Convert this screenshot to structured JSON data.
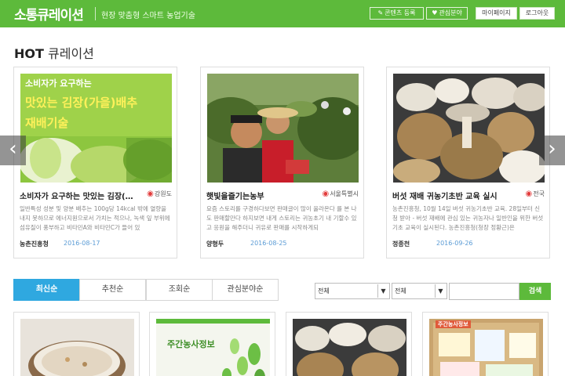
{
  "header": {
    "brand": "소통큐레이션",
    "tagline": "현장 맞춤형 스마트 농업기술",
    "buttons": {
      "register": "콘텐츠 등록",
      "interest": "관심분야",
      "mypage": "마이페이지",
      "logout": "로그아웃"
    },
    "colors": {
      "primary": "#5dba3b"
    }
  },
  "hot": {
    "title_bold": "HOT",
    "title_rest": "큐레이션",
    "cards": [
      {
        "title": "소비자가 요구하는 맛있는 김장(가을)배추 재배기술",
        "location": "강원도",
        "desc": "일반특성 성분 및 양분 배추는 100g당 14kcal 밖에 열량을 내지 못하므로 에너지원으로서 가치는 적으나, 녹색 잎 부위에 섬유질이 풍부하고 비타민A와 비타민C가 들어 있",
        "author": "농촌진흥청",
        "date": "2016-08-17",
        "image_text": [
          "소비자가 요구하는",
          "맛있는 김장(가을)배추",
          "재배기술"
        ]
      },
      {
        "title": "햇빛을즐기는농부",
        "location": "서울특별시",
        "desc": "요즘 스토리를 구경하다보면 판매글이 많이 올라온다 를 본 나도 판매할만다 하지보면 내게 스토리는 귀농초기 내 기할수 있고 응원을 해주더니 귀유로 판매를 시작하게되",
        "author": "양형두",
        "date": "2016-08-25"
      },
      {
        "title": "버섯 재배 귀농기초반 교육 실시",
        "location": "전국",
        "desc": "농촌진흥청, 10월 14일 버섯 귀농기초반 교육. 28일부터 신청 받아 - 버섯 재배에 관심 있는 귀농자나 일반인을 위한 버섯 기초 교육이 실시된다. 농촌진흥청(청장 정황근)은",
        "author": "정종천",
        "date": "2016-09-26"
      }
    ]
  },
  "tabs": [
    "최신순",
    "추천순",
    "조회순",
    "관심분야순"
  ],
  "filters": {
    "select1": "전체",
    "select2": "전체",
    "search_button": "검색"
  },
  "bottom_cards": [
    {
      "image": "porridge"
    },
    {
      "image_text": "주간농사정보"
    },
    {
      "image": "mushrooms"
    },
    {
      "image_text": "주간농사정보"
    }
  ]
}
